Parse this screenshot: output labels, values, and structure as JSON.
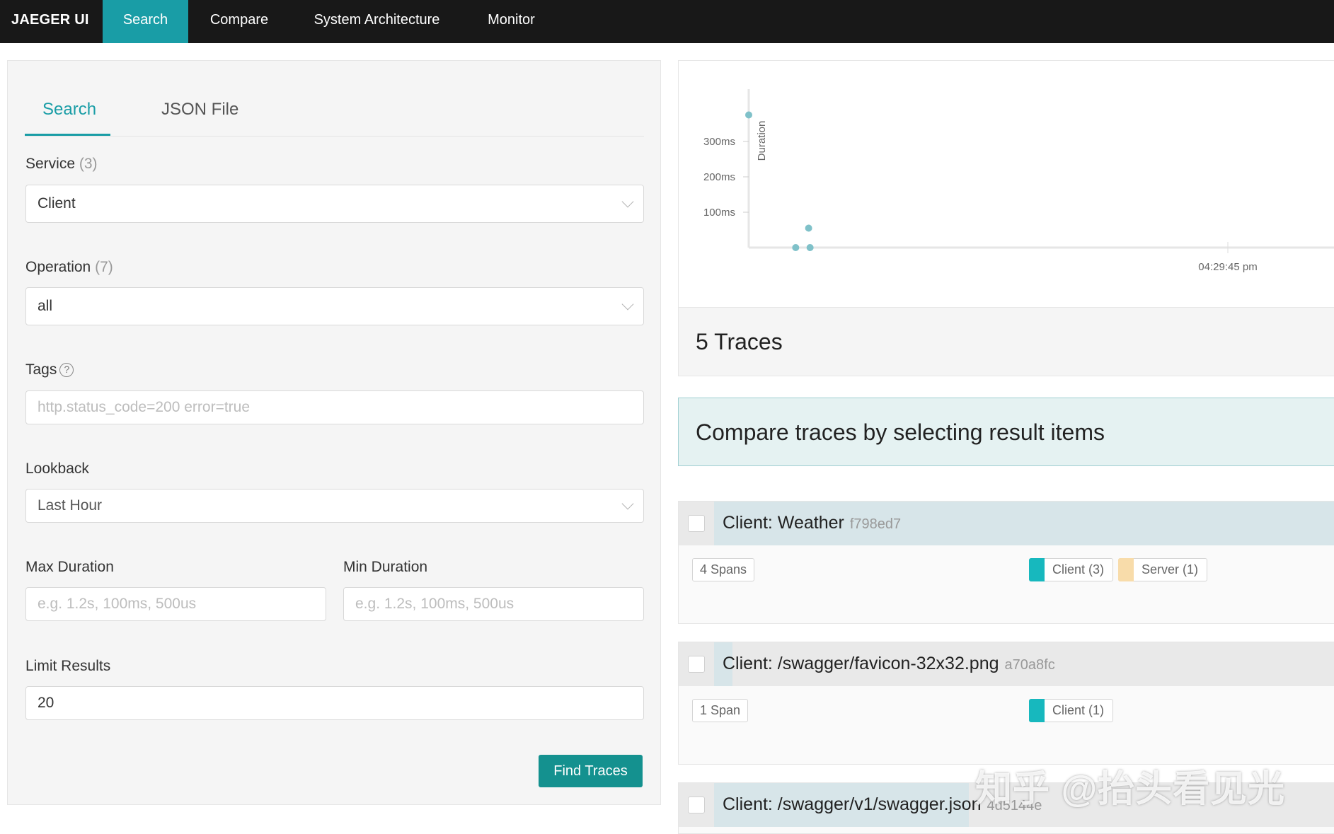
{
  "nav": {
    "brand": "JAEGER UI",
    "items": [
      {
        "label": "Search",
        "active": true
      },
      {
        "label": "Compare",
        "active": false
      },
      {
        "label": "System Architecture",
        "active": false
      },
      {
        "label": "Monitor",
        "active": false
      }
    ]
  },
  "search_panel": {
    "tabs": [
      {
        "label": "Search",
        "active": true
      },
      {
        "label": "JSON File",
        "active": false
      }
    ],
    "service": {
      "label": "Service",
      "count": "(3)",
      "value": "Client"
    },
    "operation": {
      "label": "Operation",
      "count": "(7)",
      "value": "all"
    },
    "tags": {
      "label": "Tags",
      "help": "?",
      "placeholder": "http.status_code=200 error=true"
    },
    "lookback": {
      "label": "Lookback",
      "value": "Last Hour"
    },
    "max_duration": {
      "label": "Max Duration",
      "placeholder": "e.g. 1.2s, 100ms, 500us"
    },
    "min_duration": {
      "label": "Min Duration",
      "placeholder": "e.g. 1.2s, 100ms, 500us"
    },
    "limit": {
      "label": "Limit Results",
      "value": "20"
    },
    "find_button": "Find Traces"
  },
  "chart_data": {
    "type": "scatter",
    "ylabel": "Duration",
    "y_ticks": [
      "100ms",
      "200ms",
      "300ms"
    ],
    "x_ticks": [
      "04:29:45 pm"
    ],
    "point_color": "#7fc1c9",
    "points": [
      {
        "x": 0.0,
        "y": 375
      },
      {
        "x": 0.098,
        "y": 0
      },
      {
        "x": 0.128,
        "y": 0
      },
      {
        "x": 0.125,
        "y": 55
      }
    ]
  },
  "results": {
    "count_label": "5 Traces",
    "compare_hint": "Compare traces by selecting result items",
    "traces": [
      {
        "name": "Client: Weather",
        "id": "f798ed7",
        "spans": "4 Spans",
        "duration_fraction": 1.0,
        "services": [
          {
            "label": "Client (3)",
            "color": "#17b8be"
          },
          {
            "label": "Server (1)",
            "color": "#f8dcaa"
          }
        ]
      },
      {
        "name": "Client: /swagger/favicon-32x32.png",
        "id": "a70a8fc",
        "spans": "1 Span",
        "duration_fraction": 0.03,
        "services": [
          {
            "label": "Client (1)",
            "color": "#17b8be"
          }
        ]
      },
      {
        "name": "Client: /swagger/v1/swagger.json",
        "id": "4d5144e",
        "duration_fraction": 0.41,
        "services": []
      }
    ]
  },
  "watermark": "知乎 @抬头看见光",
  "colors": {
    "accent": "#199da6",
    "nav_bg": "#181818",
    "button": "#14918f"
  }
}
